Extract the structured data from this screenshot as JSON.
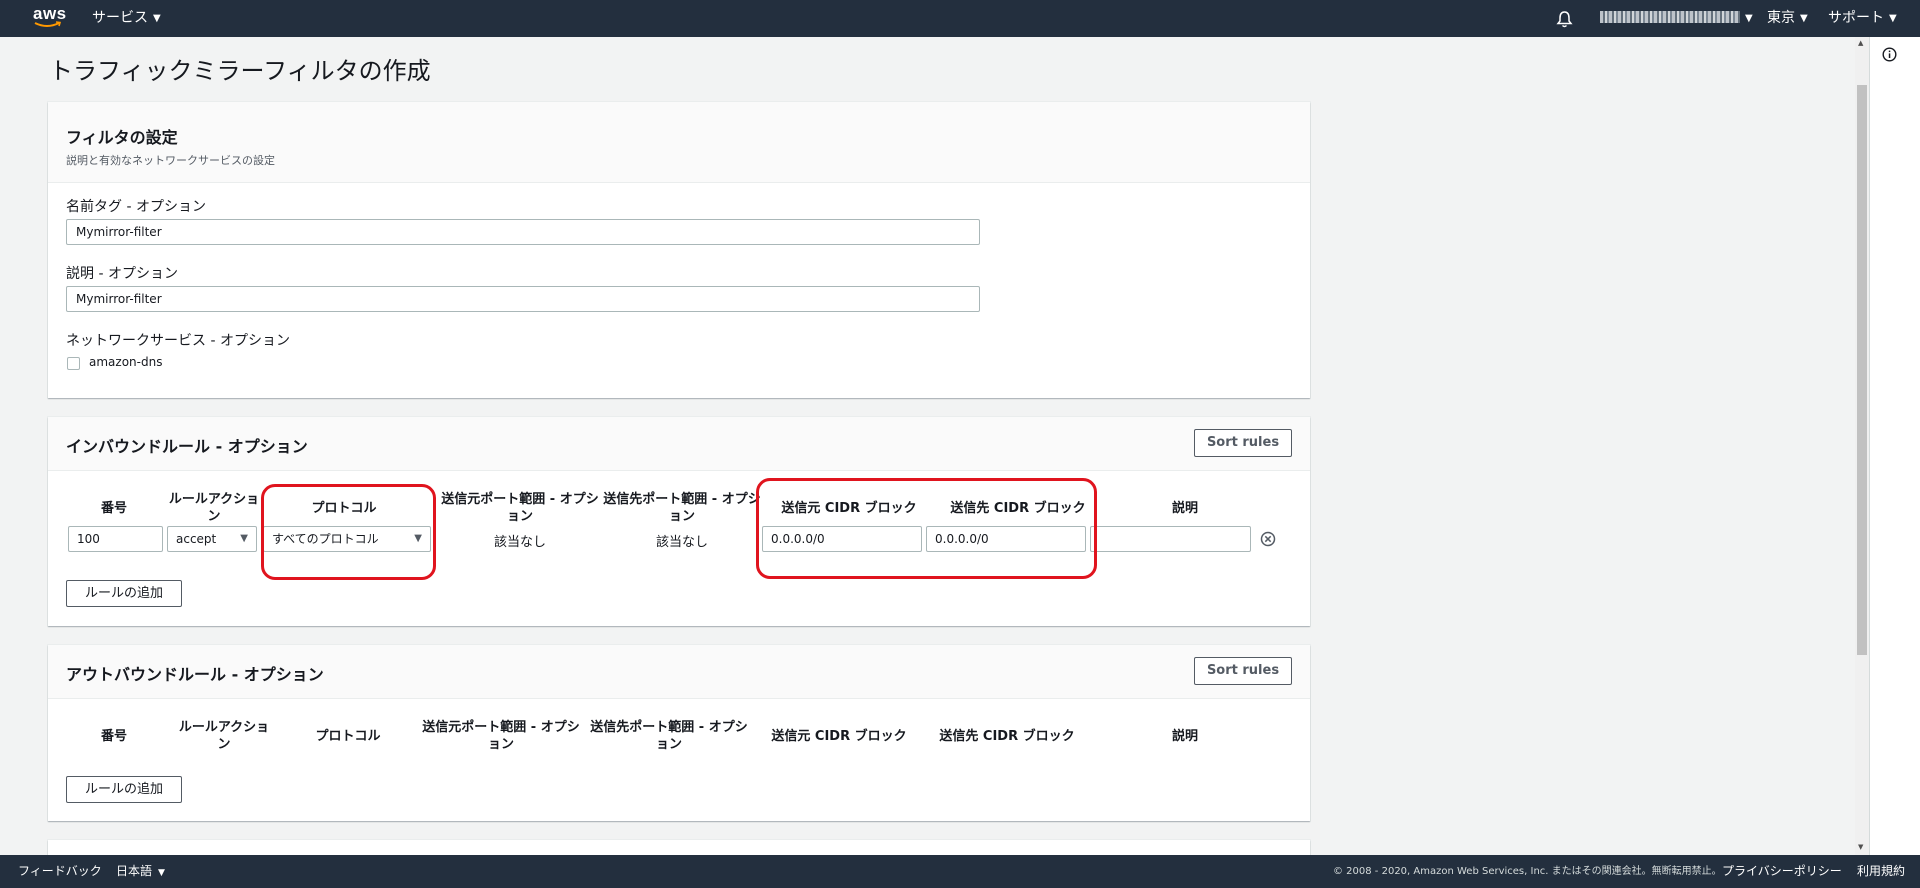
{
  "nav": {
    "logo_text": "aws",
    "services": "サービス",
    "account_text": "",
    "region": "東京",
    "support": "サポート"
  },
  "page": {
    "title": "トラフィックミラーフィルタの作成"
  },
  "filter_settings": {
    "title": "フィルタの設定",
    "subtitle": "説明と有効なネットワークサービスの設定",
    "name_label": "名前タグ - オプション",
    "name_value": "Mymirror-filter",
    "desc_label": "説明 - オプション",
    "desc_value": "Mymirror-filter",
    "network_label": "ネットワークサービス - オプション",
    "network_option": "amazon-dns"
  },
  "inbound": {
    "title": "インバウンドルール - オプション",
    "sort_label": "Sort rules",
    "columns": {
      "number": "番号",
      "action": "ルールアクション",
      "protocol": "プロトコル",
      "src_port": "送信元ポート範囲 - オプション",
      "dst_port": "送信先ポート範囲 - オプション",
      "src_cidr": "送信元 CIDR ブロック",
      "dst_cidr": "送信先 CIDR ブロック",
      "desc": "説明"
    },
    "row": {
      "number": "100",
      "action": "accept",
      "protocol": "すべてのプロトコル",
      "src_port": "該当なし",
      "dst_port": "該当なし",
      "src_cidr": "0.0.0.0/0",
      "dst_cidr": "0.0.0.0/0",
      "desc": ""
    },
    "add_label": "ルールの追加"
  },
  "outbound": {
    "title": "アウトバウンドルール - オプション",
    "sort_label": "Sort rules",
    "columns": {
      "number": "番号",
      "action": "ルールアクション",
      "protocol": "プロトコル",
      "src_port": "送信元ポート範囲 - オプション",
      "dst_port": "送信先ポート範囲 - オプション",
      "src_cidr": "送信元 CIDR ブロック",
      "dst_cidr": "送信先 CIDR ブロック",
      "desc": "説明"
    },
    "add_label": "ルールの追加"
  },
  "footer": {
    "feedback": "フィードバック",
    "language": "日本語",
    "copyright": "© 2008 - 2020, Amazon Web Services, Inc. またはその関連会社。無断転用禁止。",
    "privacy": "プライバシーポリシー",
    "terms": "利用規約"
  },
  "colors": {
    "nav_bg": "#232f3e",
    "highlight": "#e0141e",
    "page_bg": "#f2f3f3"
  },
  "icons": [
    "bell-icon",
    "info-icon",
    "remove-row-icon",
    "caret-down-icon"
  ]
}
